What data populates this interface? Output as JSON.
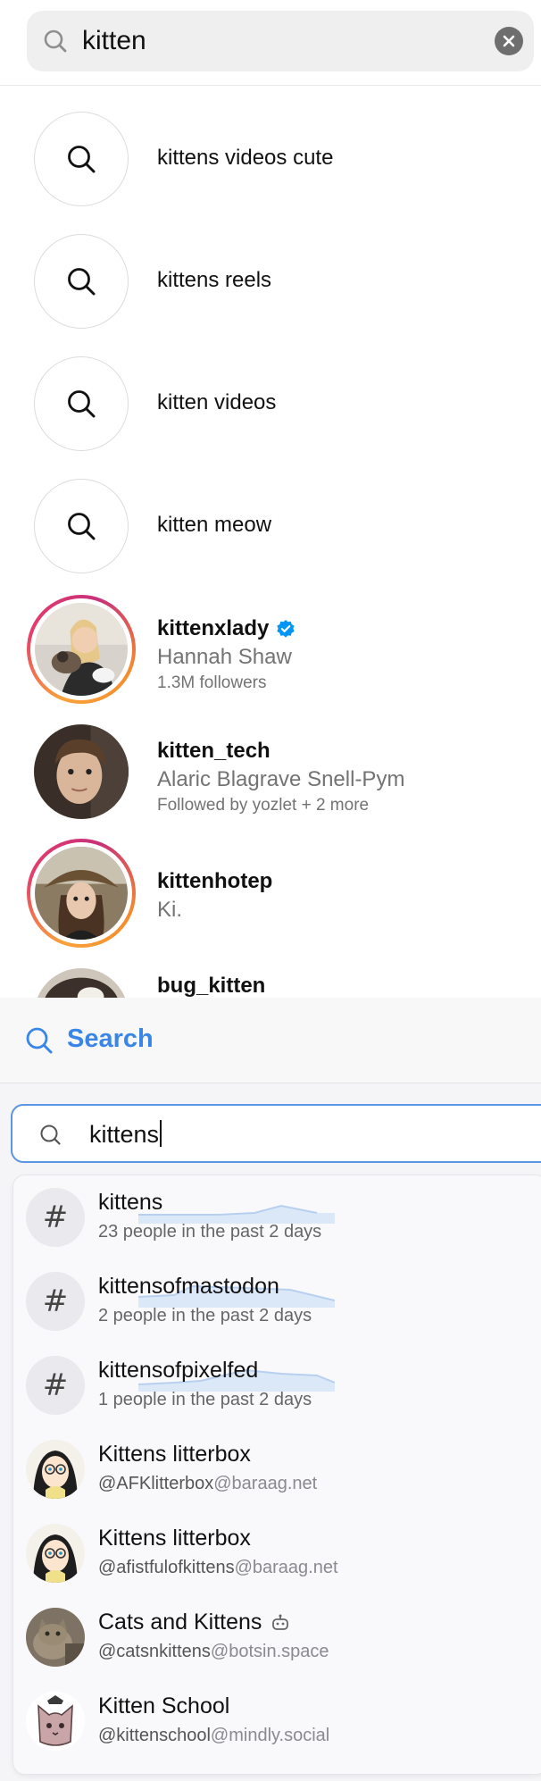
{
  "ig": {
    "search_query": "kitten",
    "suggestions": [
      {
        "label": "kittens videos cute"
      },
      {
        "label": "kittens reels"
      },
      {
        "label": "kitten videos"
      },
      {
        "label": "kitten meow"
      }
    ],
    "accounts": [
      {
        "username": "kittenxlady",
        "full_name": "Hannah Shaw",
        "meta": "1.3M followers",
        "verified": true,
        "story_ring": true
      },
      {
        "username": "kitten_tech",
        "full_name": "Alaric Blagrave Snell-Pym",
        "meta": "Followed by yozlet + 2 more",
        "verified": false,
        "story_ring": false
      },
      {
        "username": "kittenhotep",
        "full_name": "Ki.",
        "meta": "",
        "verified": false,
        "story_ring": true
      },
      {
        "username": "bug_kitten",
        "full_name": "",
        "meta": "",
        "verified": false,
        "story_ring": false
      }
    ]
  },
  "ms": {
    "header_title": "Search",
    "search_value": "kittens",
    "hashtags": [
      {
        "tag": "kittens",
        "subtitle": "23 people in the past 2 days"
      },
      {
        "tag": "kittensofmastodon",
        "subtitle": "2 people in the past 2 days"
      },
      {
        "tag": "kittensofpixelfed",
        "subtitle": "1 people in the past 2 days"
      }
    ],
    "accounts": [
      {
        "name": "Kittens litterbox",
        "acct": "@AFKlitterbox",
        "domain": "@baraag.net",
        "bot": false
      },
      {
        "name": "Kittens litterbox",
        "acct": "@afistfulofkittens",
        "domain": "@baraag.net",
        "bot": false
      },
      {
        "name": "Cats and Kittens",
        "acct": "@catsnkittens",
        "domain": "@botsin.space",
        "bot": true
      },
      {
        "name": "Kitten School",
        "acct": "@kittenschool",
        "domain": "@mindly.social",
        "bot": false
      }
    ],
    "hash_symbol": "#"
  },
  "colors": {
    "accent_blue": "#3a86e8",
    "verified_blue": "#0095f6",
    "secondary_text": "#737373"
  },
  "icons": [
    "search-icon",
    "clear-icon",
    "verified-icon",
    "hashtag-icon",
    "bot-icon"
  ]
}
